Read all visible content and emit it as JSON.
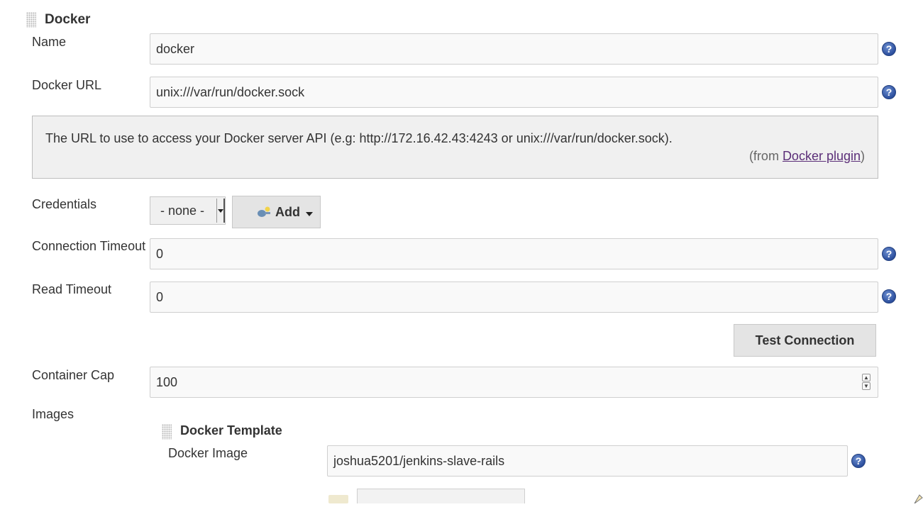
{
  "docker_section": {
    "title": "Docker",
    "name_label": "Name",
    "name_value": "docker",
    "url_label": "Docker URL",
    "url_value": "unix:///var/run/docker.sock",
    "url_help_text": "The URL to use to access your Docker server API (e.g: http://172.16.42.43:4243 or unix:///var/run/docker.sock).",
    "url_help_from_prefix": "(from ",
    "url_help_from_link": "Docker plugin",
    "url_help_from_suffix": ")",
    "credentials_label": "Credentials",
    "credentials_selected": "- none -",
    "add_button_label": "Add",
    "connection_timeout_label": "Connection Timeout",
    "connection_timeout_value": "0",
    "read_timeout_label": "Read Timeout",
    "read_timeout_value": "0",
    "test_connection_label": "Test Connection",
    "container_cap_label": "Container Cap",
    "container_cap_value": "100",
    "images_label": "Images"
  },
  "template_section": {
    "title": "Docker Template",
    "image_label": "Docker Image",
    "image_value": "joshua5201/jenkins-slave-rails"
  },
  "icons": {
    "help": "question-mark-circle-icon",
    "drag": "drag-handle-icon",
    "key": "key-icon",
    "dropdown": "caret-down-icon"
  },
  "colors": {
    "help_icon": "#2c4f9e",
    "link": "#5b2e78",
    "field_border": "#cfcfcf",
    "help_box_bg": "#f0f0f0"
  }
}
